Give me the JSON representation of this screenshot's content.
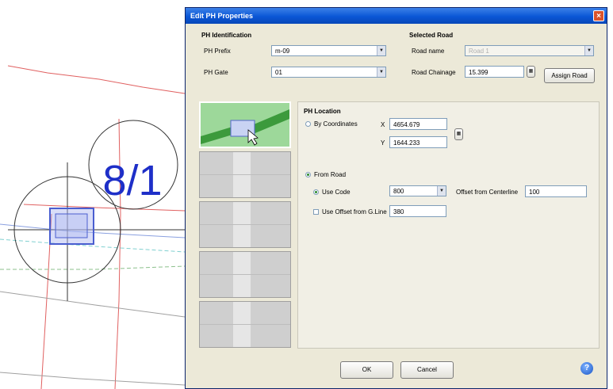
{
  "cad": {
    "label": "8/1"
  },
  "dialog": {
    "title": "Edit PH Properties",
    "close_symbol": "×",
    "ph_id": {
      "group": "PH Identification",
      "ph_prefix_label": "PH Prefix",
      "ph_prefix_value": "m-09",
      "ph_gate_label": "PH Gate",
      "ph_gate_value": "01"
    },
    "selected_road": {
      "group": "Selected Road",
      "road_name_label": "Road name",
      "road_name_value": "Road 1",
      "road_chainage_label": "Road Chainage",
      "road_chainage_value": "15.399",
      "assign_road_button": "Assign Road"
    },
    "ph_location": {
      "group": "PH Location",
      "by_coordinates_label": "By Coordinates",
      "x_label": "X",
      "x_value": "4654.679",
      "y_label": "Y",
      "y_value": "1644.233",
      "from_road_label": "From Road",
      "use_code_label": "Use Code",
      "use_code_value": "800",
      "offset_from_centerline_label": "Offset from Centerline",
      "offset_value": "100",
      "use_offset_label": "Use Offset from G.Line",
      "use_offset_value": "380"
    },
    "ok_button": "OK",
    "cancel_button": "Cancel",
    "help_symbol": "?"
  }
}
